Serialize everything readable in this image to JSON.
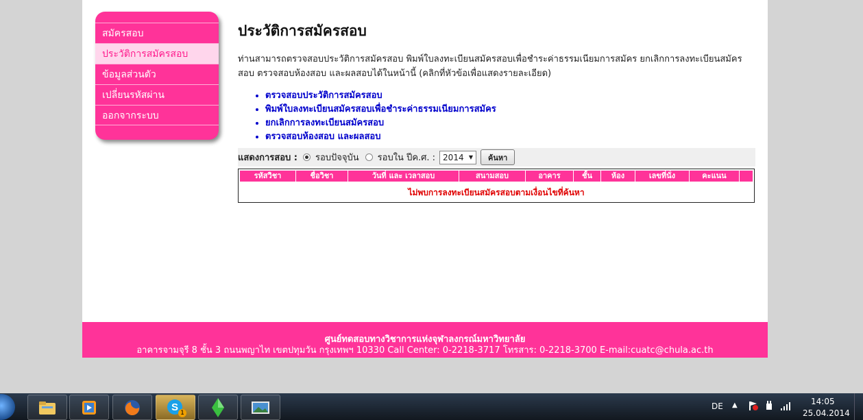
{
  "sidebar": {
    "items": [
      {
        "label": "สมัครสอบ"
      },
      {
        "label": "ประวัติการสมัครสอบ"
      },
      {
        "label": "ข้อมูลส่วนตัว"
      },
      {
        "label": "เปลี่ยนรหัสผ่าน"
      },
      {
        "label": "ออกจากระบบ"
      }
    ]
  },
  "main": {
    "title": "ประวัติการสมัครสอบ",
    "intro": "ท่านสามารถตรวจสอบประวัติการสมัครสอบ พิมพ์ใบลงทะเบียนสมัครสอบเพื่อชำระค่าธรรมเนียมการสมัคร ยกเลิกการลงทะเบียนสมัครสอบ ตรวจสอบห้องสอบ และผลสอบได้ในหน้านี้ (คลิกที่หัวข้อเพื่อแสดงรายละเอียด)",
    "links": [
      "ตรวจสอบประวัติการสมัครสอบ",
      "พิมพ์ใบลงทะเบียนสมัครสอบเพื่อชำระค่าธรรมเนียมการสมัคร",
      "ยกเลิกการลงทะเบียนสมัครสอบ",
      "ตรวจสอบห้องสอบ และผลสอบ"
    ],
    "filter": {
      "label": "แสดงการสอบ :",
      "radio_current": "รอบปัจจุบัน",
      "radio_year": "รอบใน ปีค.ศ. :",
      "year_value": "2014",
      "search_button": "ค้นหา"
    },
    "table": {
      "headers": [
        "รหัสวิชา",
        "ชื่อวิชา",
        "วันที่ และ เวลาสอบ",
        "สนามสอบ",
        "อาคาร",
        "ชั้น",
        "ห้อง",
        "เลขที่นั่ง",
        "คะแนน",
        ""
      ],
      "no_data": "ไม่พบการลงทะเบียนสมัครสอบตามเงื่อนไขที่ค้นหา"
    }
  },
  "footer": {
    "line1": "ศูนย์ทดสอบทางวิชาการแห่งจุฬาลงกรณ์มหาวิทยาลัย",
    "line2": "อาคารจามจุรี 8 ชั้น 3 ถนนพญาไท เขตปทุมวัน กรุงเทพฯ 10330 Call Center: 0-2218-3717 โทรสาร: 0-2218-3700 E-mail:cuatc@chula.ac.th"
  },
  "taskbar": {
    "apps": [
      "explorer-icon",
      "media-player-icon",
      "firefox-icon",
      "skype-icon",
      "sims-icon",
      "photos-icon"
    ],
    "skype_badge": "1",
    "language": "DE",
    "time": "14:05",
    "date": "25.04.2014"
  },
  "colors": {
    "accent": "#ff3399",
    "link": "#0000cc",
    "error": "#e00000"
  }
}
